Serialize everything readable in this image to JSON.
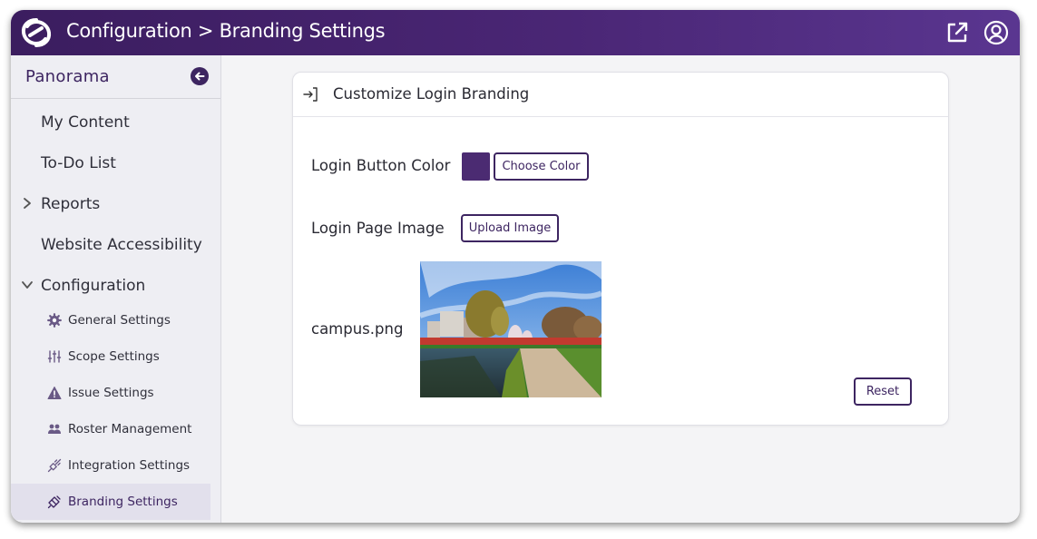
{
  "header": {
    "title": "Configuration > Branding Settings",
    "icons": [
      "app-logo",
      "external-link-icon",
      "account-icon"
    ]
  },
  "sidebar": {
    "heading": "Panorama",
    "items": [
      {
        "label": "My Content"
      },
      {
        "label": "To-Do List"
      },
      {
        "label": "Reports",
        "expandable": true,
        "expanded": false
      },
      {
        "label": "Website Accessibility"
      },
      {
        "label": "Configuration",
        "expandable": true,
        "expanded": true
      }
    ],
    "sub_items": [
      {
        "label": "General Settings",
        "icon": "gear-icon"
      },
      {
        "label": "Scope Settings",
        "icon": "sliders-icon"
      },
      {
        "label": "Issue Settings",
        "icon": "warning-icon"
      },
      {
        "label": "Roster Management",
        "icon": "people-icon"
      },
      {
        "label": "Integration Settings",
        "icon": "plug-icon"
      },
      {
        "label": "Branding Settings",
        "icon": "paint-icon",
        "active": true
      }
    ]
  },
  "card": {
    "title": "Customize Login Branding",
    "button_color_label": "Login Button Color",
    "button_color_value": "#4b2b72",
    "choose_color": "Choose Color",
    "page_image_label": "Login Page Image",
    "upload_image": "Upload Image",
    "file_name": "campus.png",
    "reset": "Reset"
  },
  "colors": {
    "brand": "#3d2561",
    "header_gradient_start": "#3b1d5f",
    "header_gradient_end": "#5a3690"
  }
}
